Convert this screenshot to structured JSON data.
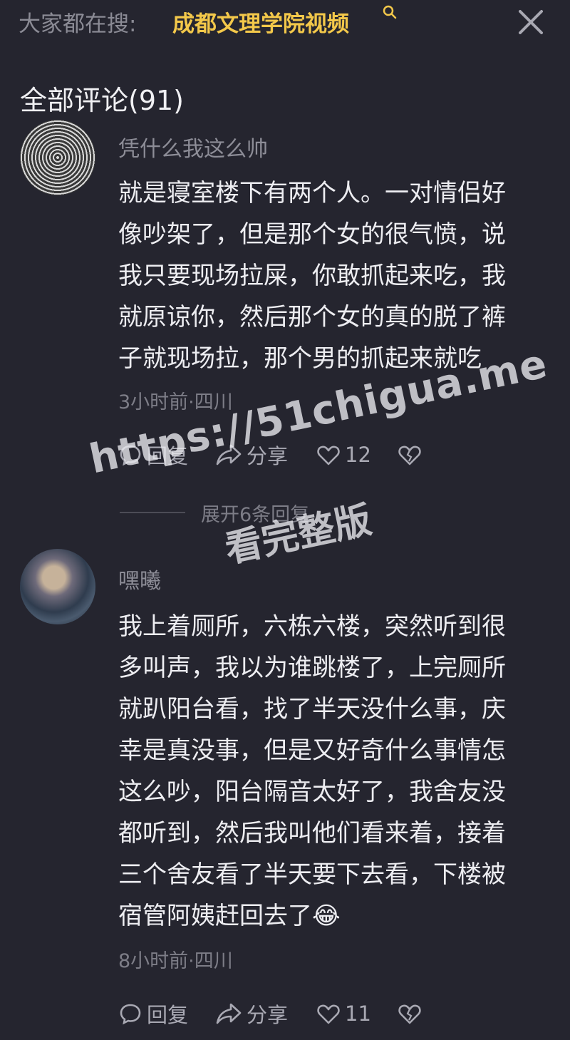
{
  "search": {
    "prefix": "大家都在搜:",
    "term": "成都文理学院视频"
  },
  "comments_header": {
    "title": "全部评论(91)"
  },
  "comments": [
    {
      "username": "凭什么我这么帅",
      "lines": [
        "就是寝室楼下有两个人。一对情侣好",
        "像吵架了，但是那个女的很气愤，说",
        "我只要现场拉屎，你敢抓起来吃，我",
        "就原谅你，然后那个女的真的脱了裤",
        "子就现场拉，那个男的抓起来就吃"
      ],
      "meta": "3小时前·四川",
      "reply_label": "回复",
      "share_label": "分享",
      "like_count": "12"
    },
    {
      "username": "嘿曦",
      "lines": [
        "我上着厕所，六栋六楼，突然听到很",
        "多叫声，我以为谁跳楼了，上完厕所",
        "就趴阳台看，找了半天没什么事，庆",
        "幸是真没事，但是又好奇什么事情怎",
        "这么吵，阳台隔音太好了，我舍友没",
        "都听到，然后我叫他们看来着，接着",
        "三个舍友看了半天要下去看，下楼被",
        "宿管阿姨赶回去了😂"
      ],
      "meta": "8小时前·四川",
      "reply_label": "回复",
      "share_label": "分享",
      "like_count": "11"
    }
  ],
  "expand_replies": "展开6条回复",
  "watermark": {
    "line1": "https://51chigua.me",
    "line2": "看完整版"
  },
  "colors": {
    "background": "#25252f",
    "search_term": "#f3c84a",
    "muted_text": "#8d8d97",
    "body_text": "#ededf1"
  },
  "icons": [
    "search-icon",
    "close-icon",
    "reply-icon",
    "share-icon",
    "heart-icon",
    "dislike-icon"
  ]
}
